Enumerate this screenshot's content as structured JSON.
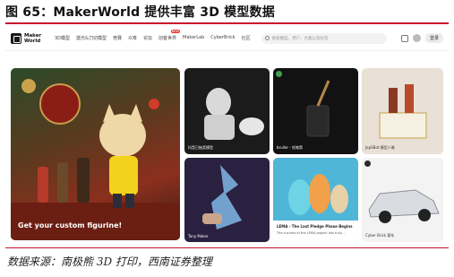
{
  "figure": {
    "title": "图 65：MakerWorld 提供丰富 3D 模型数据",
    "source": "数据来源：南极熊 3D 打印，西南证券整理"
  },
  "nav": {
    "logo_text": "Maker World",
    "items": [
      "3D模型",
      "激光&刀切模型",
      "竞赛",
      "众筹",
      "论坛",
      "创客世界",
      "MakerLab",
      "CyberBrick",
      "社区"
    ],
    "badge": "NEW",
    "search_placeholder": "搜索模型、用户、合集以及标签",
    "login_label": "登录"
  },
  "cards": {
    "hero_caption": "Get your custom figurine!",
    "c1_caption": "抖音已抽奖模型",
    "c2_caption": "bruller - 铅笔筒",
    "c3_caption": "JapSBot 模型人像",
    "c4_caption": "Tony Maker",
    "c5_title": "LEMA - The Last Pledge Phase Begins",
    "c5_caption": "The success of the LEMA project has truly ...",
    "c6_caption": "Cyber Brick 赛车"
  },
  "colors": {
    "accent_red": "#c8102e"
  }
}
